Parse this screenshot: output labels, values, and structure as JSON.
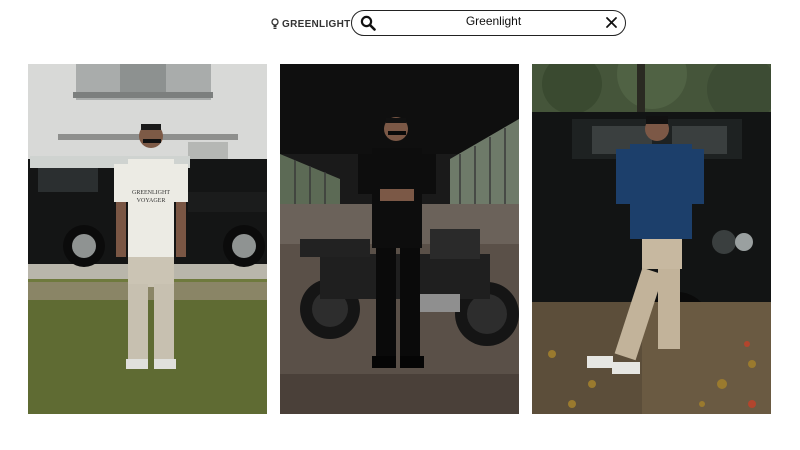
{
  "brand": {
    "name": "GREENLIGHT",
    "icon": "bulb-icon"
  },
  "search": {
    "value": "Greenlight",
    "search_icon": "search-icon",
    "clear_icon": "close-icon"
  },
  "results": [
    {
      "print_text": "GREENLIGHT VOYAGER",
      "subject": "white-tee-beige-pants-with-black-suv"
    },
    {
      "subject": "black-shirt-with-motorcycle"
    },
    {
      "subject": "navy-hoodie-with-black-suv"
    }
  ],
  "colors": {
    "search_border": "#222222",
    "logo_text": "#333333",
    "page_bg": "#ffffff"
  }
}
